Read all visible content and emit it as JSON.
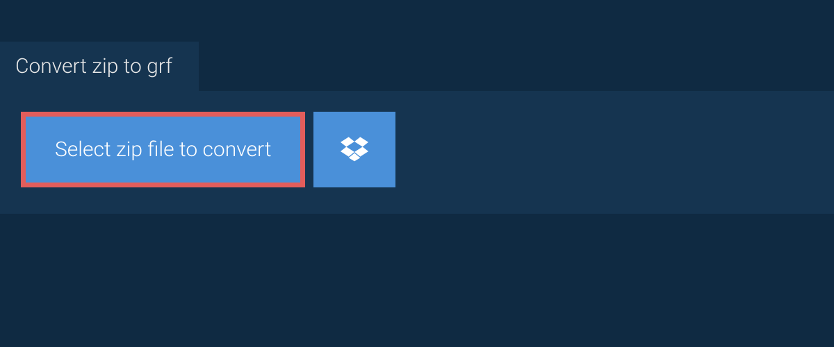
{
  "tab": {
    "title": "Convert zip to grf"
  },
  "actions": {
    "select_file_label": "Select zip file to convert"
  },
  "colors": {
    "page_bg": "#0f2a42",
    "panel_bg": "#153450",
    "button_bg": "#4a90d9",
    "highlight_border": "#e35d5b"
  }
}
